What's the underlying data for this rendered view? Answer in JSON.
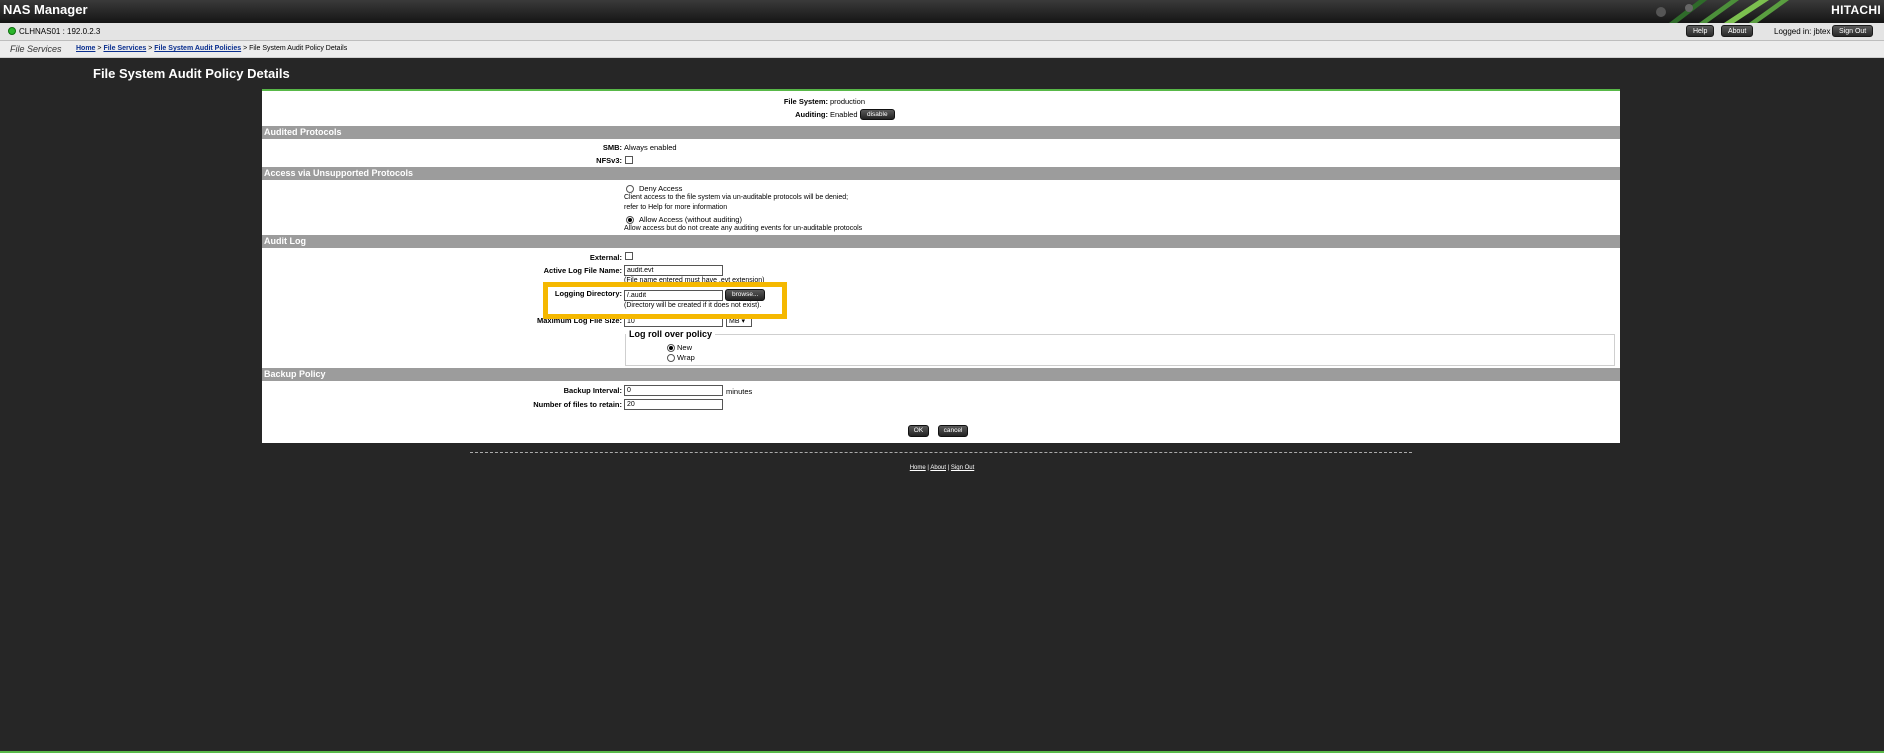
{
  "app": {
    "title": "NAS Manager",
    "brand": "HITACHI"
  },
  "server": {
    "label": "CLHNAS01 : 192.0.2.3",
    "logged_in": "Logged in: jbtex"
  },
  "header_buttons": {
    "help": "Help",
    "about": "About",
    "sign_out": "Sign Out"
  },
  "nav": {
    "section": "File Services",
    "crumb_home": "Home",
    "sep": ">",
    "crumb_file_services": "File Services",
    "crumb_policies": "File System Audit Policies",
    "crumb_current": "File System Audit Policy Details"
  },
  "page": {
    "title": "File System Audit Policy Details"
  },
  "summary": {
    "file_system_label": "File System:",
    "file_system_value": "production",
    "auditing_label": "Auditing:",
    "auditing_value": "Enabled",
    "disable_button": "disable"
  },
  "audited_protocols": {
    "header": "Audited Protocols",
    "smb_label": "SMB:",
    "smb_value": "Always enabled",
    "nfs_label": "NFSv3:"
  },
  "unsupported": {
    "header": "Access via Unsupported Protocols",
    "deny_label": "Deny Access",
    "deny_desc1": "Client access to the file system via un-auditable protocols will be denied;",
    "deny_desc2": "refer to Help for more information",
    "allow_label": "Allow Access (without auditing)",
    "allow_desc": "Allow access but do not create any auditing events for un-auditable protocols"
  },
  "audit_log": {
    "header": "Audit Log",
    "external_label": "External:",
    "active_log_label": "Active Log File Name:",
    "active_log_value": "audit.evt",
    "active_log_note": "(File name entered must have .evt extension)",
    "logging_dir_label": "Logging Directory:",
    "logging_dir_value": "/.audit",
    "browse_button": "browse...",
    "logging_dir_note": "(Directory will be created if it does not exist).",
    "max_size_label": "Maximum Log File Size:",
    "max_size_value": "10",
    "max_size_unit": "MB",
    "rollover_legend": "Log roll over policy",
    "rollover_new": "New",
    "rollover_wrap": "Wrap"
  },
  "backup": {
    "header": "Backup Policy",
    "interval_label": "Backup Interval:",
    "interval_value": "0",
    "interval_unit": "minutes",
    "retain_label": "Number of files to retain:",
    "retain_value": "20"
  },
  "actions": {
    "ok": "OK",
    "cancel": "cancel"
  },
  "footer": {
    "home": "Home",
    "about": "About",
    "sign_out": "Sign Out",
    "sep": "|"
  }
}
